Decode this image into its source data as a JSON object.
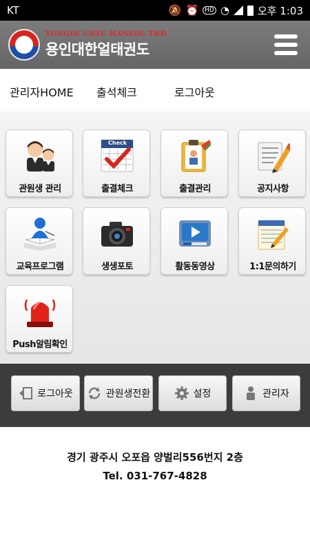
{
  "status_bar": {
    "carrier": "KT",
    "time": "오후 1:03",
    "hd_label": "HD"
  },
  "header": {
    "logo_sub": "YONGIN UNIV. HANEOL TKD",
    "logo_main": "용인대한얼태권도",
    "menu_icon": "hamburger-icon"
  },
  "top_nav": {
    "items": [
      "관리자HOME",
      "출석체크",
      "로그아웃"
    ]
  },
  "grid": {
    "tiles": [
      {
        "label": "관원생 관리",
        "icon": "students-icon"
      },
      {
        "label": "출결체크",
        "icon": "check-calendar-icon"
      },
      {
        "label": "출결관리",
        "icon": "clipboard-icon"
      },
      {
        "label": "공지사항",
        "icon": "notice-pencil-icon"
      },
      {
        "label": "교육프로그램",
        "icon": "education-icon"
      },
      {
        "label": "생생포토",
        "icon": "camera-icon"
      },
      {
        "label": "활동동영상",
        "icon": "video-icon"
      },
      {
        "label": "1:1문의하기",
        "icon": "notepad-pencil-icon"
      },
      {
        "label": "Push알림확인",
        "icon": "siren-icon"
      }
    ],
    "check_badge": "Check"
  },
  "bottom_bar": {
    "buttons": [
      {
        "label": "로그아웃",
        "icon": "logout-icon"
      },
      {
        "label": "관원생전환",
        "icon": "refresh-icon"
      },
      {
        "label": "설정",
        "icon": "gear-icon"
      },
      {
        "label": "관리자",
        "icon": "admin-user-icon"
      }
    ]
  },
  "footer": {
    "address": "경기 광주시 오포읍 양벌리556번지 2층",
    "tel": "Tel. 031-767-4828"
  },
  "colors": {
    "header_bg": "#6e6e6e",
    "bottom_bar_bg": "#3c3c3c",
    "accent_red": "#d7261e"
  }
}
